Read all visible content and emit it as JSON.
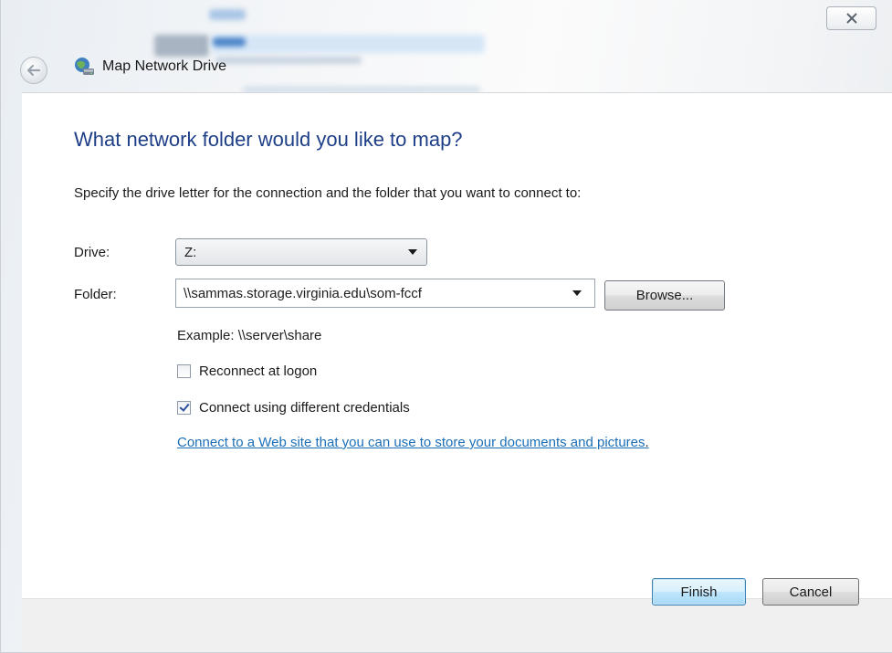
{
  "window": {
    "title": "Map Network Drive"
  },
  "page": {
    "heading": "What network folder would you like to map?",
    "instructions": "Specify the drive letter for the connection and the folder that you want to connect to:"
  },
  "form": {
    "drive_label": "Drive:",
    "drive_value": "Z:",
    "folder_label": "Folder:",
    "folder_value": "\\\\sammas.storage.virginia.edu\\som-fccf",
    "browse_label": "Browse...",
    "example_text": "Example: \\\\server\\share",
    "reconnect_label": "Reconnect at logon",
    "reconnect_checked": false,
    "credentials_label": "Connect using different credentials",
    "credentials_checked": true,
    "web_link_text": "Connect to a Web site that you can use to store your documents and pictures",
    "web_link_suffix": "."
  },
  "footer": {
    "finish_label": "Finish",
    "cancel_label": "Cancel"
  },
  "colors": {
    "heading": "#1e3f87",
    "link": "#1b6fb8",
    "finish_accent": "#3c7fb1"
  },
  "icons": [
    "close-icon",
    "back-arrow-icon",
    "network-drive-icon",
    "dropdown-arrow-icon",
    "checkmark-icon"
  ]
}
